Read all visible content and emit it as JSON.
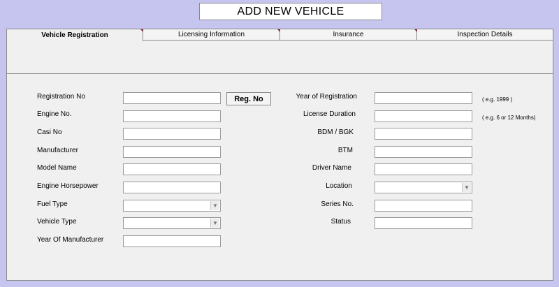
{
  "title": "ADD NEW VEHICLE",
  "tabs": [
    {
      "label": "Vehicle Registration"
    },
    {
      "label": "Licensing Information"
    },
    {
      "label": "Insurance"
    },
    {
      "label": "Inspection Details"
    }
  ],
  "left_fields": [
    {
      "label": "Registration No"
    },
    {
      "label": "Engine No."
    },
    {
      "label": "Casi No"
    },
    {
      "label": "Manufacturer"
    },
    {
      "label": "Model Name"
    },
    {
      "label": "Engine Horsepower"
    },
    {
      "label": "Fuel Type"
    },
    {
      "label": "Vehicle Type"
    },
    {
      "label": "Year Of Manufacturer"
    }
  ],
  "reg_button": "Reg. No",
  "right_fields": [
    {
      "label": "Year of Registration"
    },
    {
      "label": "License Duration"
    },
    {
      "label": "BDM / BGK"
    },
    {
      "label": "BTM"
    },
    {
      "label": "Driver Name"
    },
    {
      "label": "Location"
    },
    {
      "label": "Series No."
    },
    {
      "label": "Status"
    }
  ],
  "hints": {
    "year_registration": "( e.g. 1999 )",
    "license_duration": "( e.g. 6 or 12 Months)"
  },
  "icons": {
    "dropdown": "chevron-down-icon"
  }
}
